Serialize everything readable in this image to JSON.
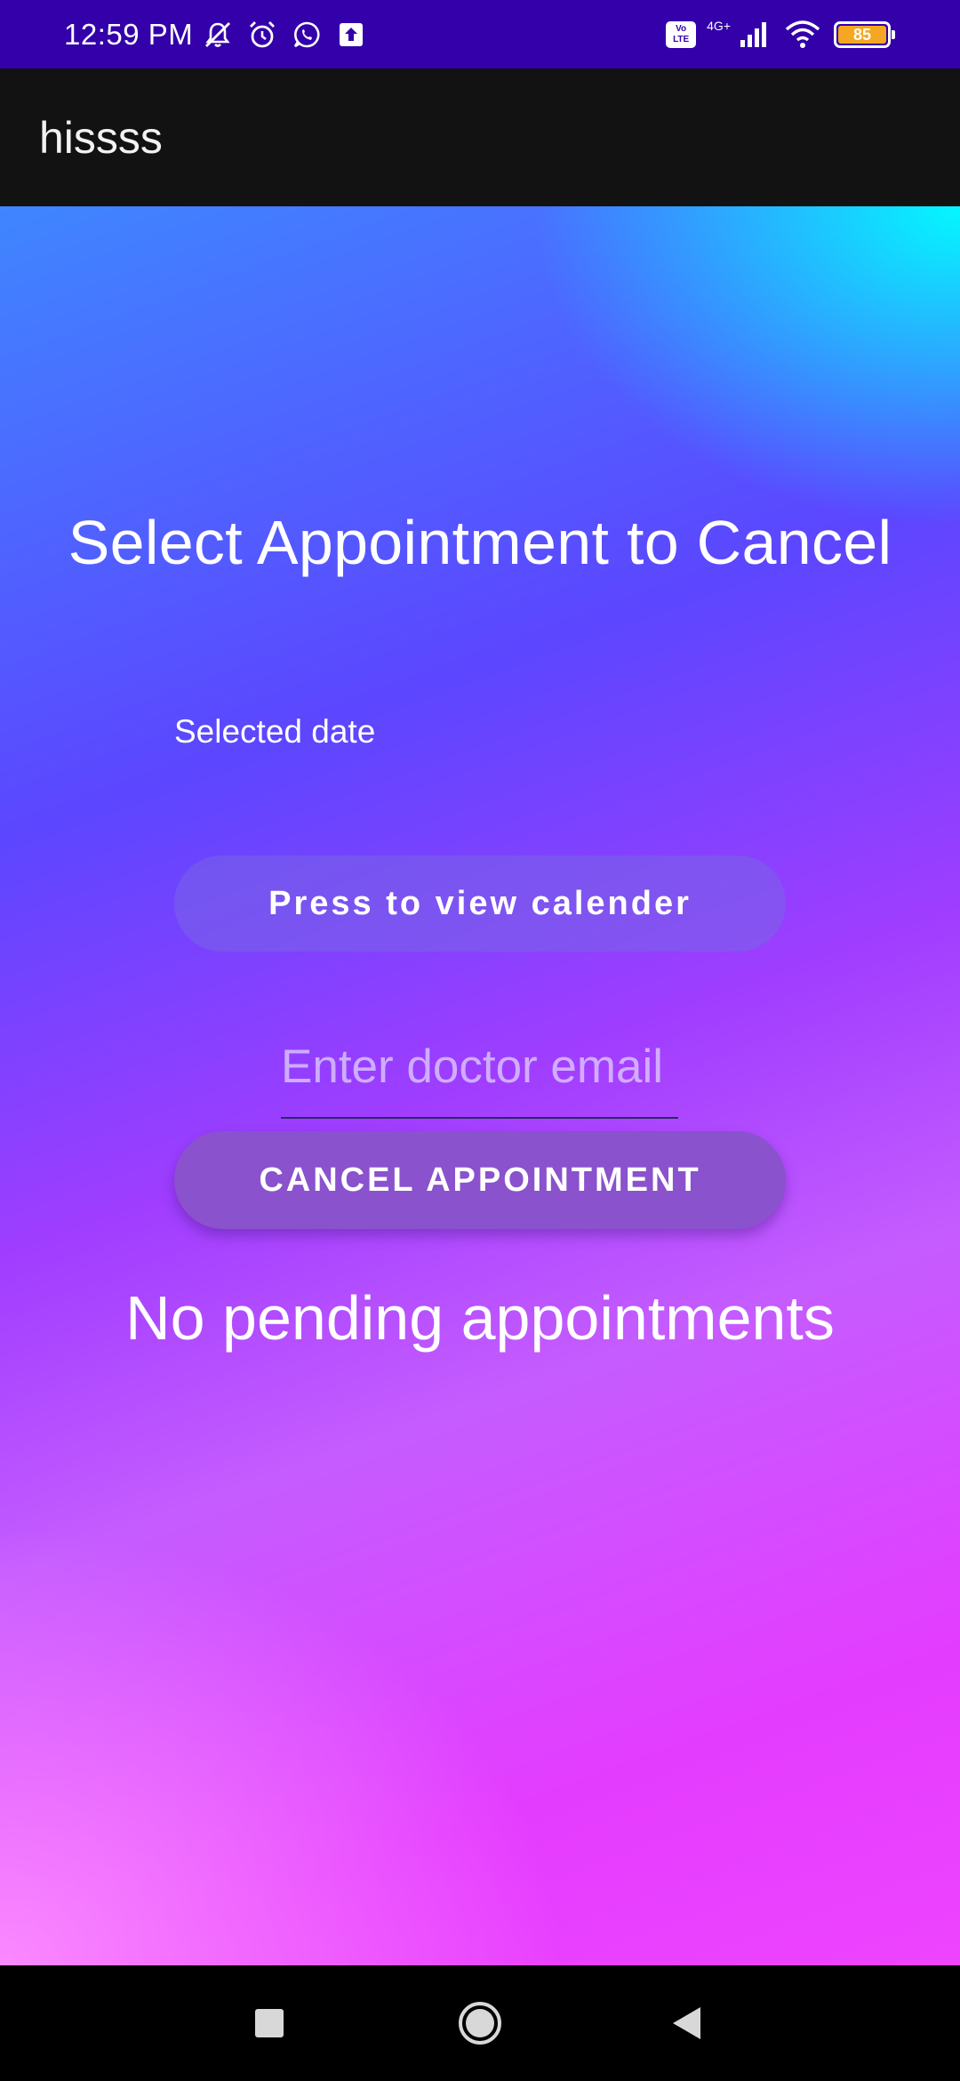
{
  "status_bar": {
    "time": "12:59 PM",
    "left_icons": [
      "muted-notification-icon",
      "alarm-icon",
      "whatsapp-icon",
      "upload-icon"
    ],
    "volte_line1": "Vo",
    "volte_line2": "LTE",
    "network_type": "4G+",
    "battery_level": "85",
    "right_icons": [
      "volte-icon",
      "signal-icon",
      "wifi-icon",
      "battery-icon"
    ]
  },
  "app_bar": {
    "title": "hissss"
  },
  "main": {
    "heading": "Select Appointment to Cancel",
    "selected_date_label": "Selected date",
    "calendar_button_label": "Press to view calender",
    "email_input": {
      "placeholder": "Enter doctor email",
      "value": ""
    },
    "cancel_button_label": "CANCEL APPOINTMENT",
    "empty_message": "No pending appointments"
  },
  "nav_bar": {
    "buttons": [
      "recents-icon",
      "home-icon",
      "back-icon"
    ]
  },
  "colors": {
    "status_bar": "#3300aa",
    "app_bar": "#121212",
    "cancel_button": "#8a52cc",
    "battery": "#f5a623"
  }
}
